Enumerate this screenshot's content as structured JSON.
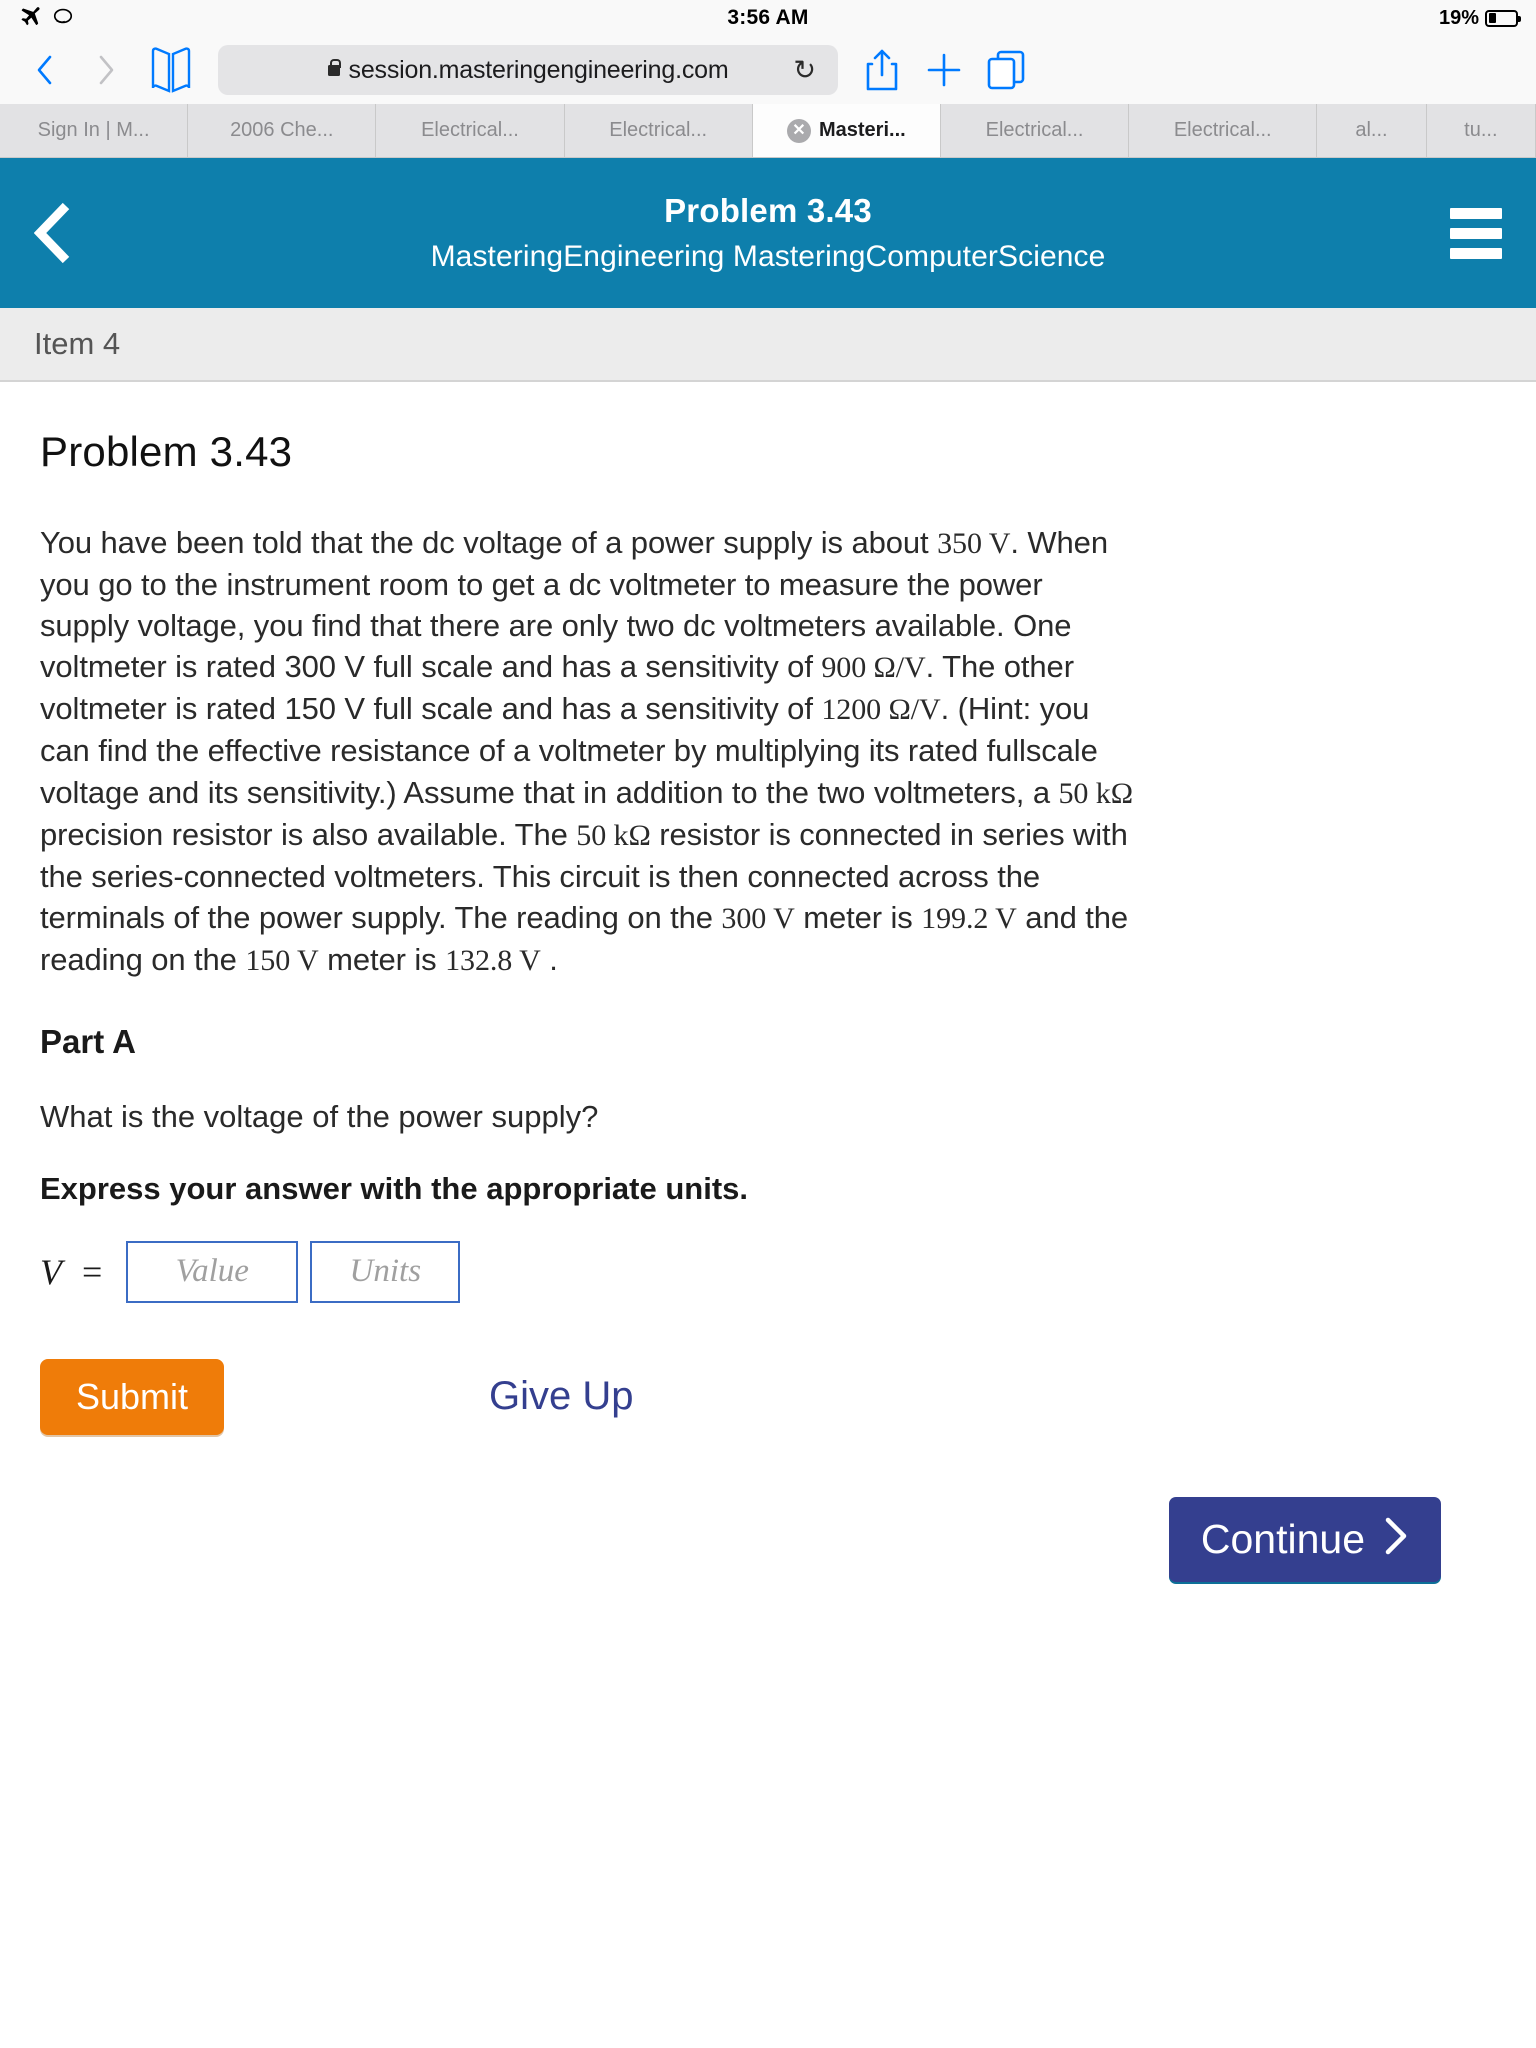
{
  "status_bar": {
    "airplane_icon": "airplane-mode-icon",
    "sync_icon": "sync-icon",
    "time": "3:56 AM",
    "battery_percent": "19%"
  },
  "browser": {
    "back_label": "‹",
    "forward_label": "›",
    "bookmarks_icon": "book-icon",
    "url": "session.masteringengineering.com",
    "lock_icon": "lock-icon",
    "reload_icon": "↻",
    "share_icon": "share-icon",
    "new_tab_icon": "plus-icon",
    "tabs_icon": "tabs-icon",
    "tabs": [
      {
        "label": "Sign In | M...",
        "active": false,
        "narrow": false
      },
      {
        "label": "2006 Che...",
        "active": false,
        "narrow": false
      },
      {
        "label": "Electrical...",
        "active": false,
        "narrow": false
      },
      {
        "label": "Electrical...",
        "active": false,
        "narrow": false
      },
      {
        "label": "Masteri...",
        "active": true,
        "narrow": false
      },
      {
        "label": "Electrical...",
        "active": false,
        "narrow": false
      },
      {
        "label": "Electrical...",
        "active": false,
        "narrow": false
      },
      {
        "label": "al...",
        "active": false,
        "narrow": true
      },
      {
        "label": "tu...",
        "active": false,
        "narrow": true
      }
    ]
  },
  "app_header": {
    "back_icon": "chevron-left-icon",
    "title": "Problem 3.43",
    "subtitle": "MasteringEngineering MasteringComputerScience",
    "menu_icon": "hamburger-menu-icon",
    "background_color": "#0e7fac"
  },
  "item_bar": {
    "label": "Item 4"
  },
  "problem": {
    "title": "Problem 3.43",
    "body_segments": [
      {
        "type": "text",
        "value": "You have been told that the dc voltage of a power supply is about "
      },
      {
        "type": "math",
        "value": "350 V"
      },
      {
        "type": "text",
        "value": ". When you go to the instrument room to get a dc voltmeter to measure the power supply voltage, you find that there are only two dc voltmeters available. One voltmeter is rated 300 V full scale and has a sensitivity of "
      },
      {
        "type": "math",
        "value": "900 Ω/V"
      },
      {
        "type": "text",
        "value": ". The other voltmeter is rated 150 V full scale and has a sensitivity of "
      },
      {
        "type": "math",
        "value": "1200 Ω/V"
      },
      {
        "type": "text",
        "value": ". (Hint: you can find the effective resistance of a voltmeter by multiplying its rated fullscale voltage and its sensitivity.) Assume that in addition to the two voltmeters, a "
      },
      {
        "type": "math",
        "value": "50 kΩ"
      },
      {
        "type": "text",
        "value": " precision resistor is also available. The "
      },
      {
        "type": "math",
        "value": "50 kΩ"
      },
      {
        "type": "text",
        "value": " resistor is connected in series with the series-connected voltmeters. This circuit is then connected across the terminals of the power supply. The reading on the "
      },
      {
        "type": "math",
        "value": "300 V"
      },
      {
        "type": "text",
        "value": " meter is "
      },
      {
        "type": "math",
        "value": "199.2 V"
      },
      {
        "type": "text",
        "value": " and the reading on the "
      },
      {
        "type": "math",
        "value": "150 V"
      },
      {
        "type": "text",
        "value": " meter is "
      },
      {
        "type": "math",
        "value": "132.8 V"
      },
      {
        "type": "text",
        "value": " ."
      }
    ],
    "part_heading": "Part A",
    "question": "What is the voltage of the power supply?",
    "instruction": "Express your answer with the appropriate units.",
    "answer": {
      "variable": "V",
      "equals": "=",
      "value_placeholder": "Value",
      "value": "",
      "units_placeholder": "Units",
      "units": ""
    },
    "buttons": {
      "submit": "Submit",
      "give_up": "Give Up",
      "continue": "Continue",
      "continue_arrow": "›"
    },
    "colors": {
      "submit_bg": "#ef7c09",
      "give_up_text": "#343f8f",
      "continue_bg": "#343f8f",
      "input_border": "#3b6cc4"
    }
  }
}
